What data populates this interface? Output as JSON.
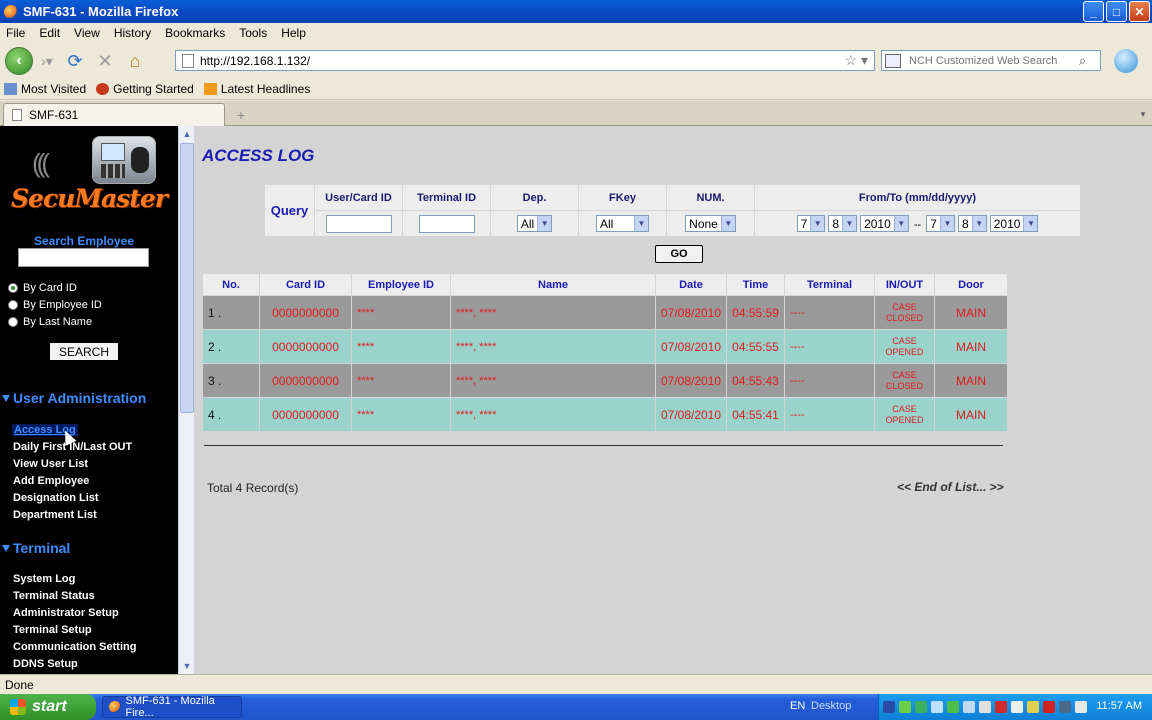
{
  "window": {
    "title": "SMF-631 - Mozilla Firefox",
    "controls": {
      "minimize": "_",
      "maximize": "□",
      "close": "✕"
    }
  },
  "menubar": [
    "File",
    "Edit",
    "View",
    "History",
    "Bookmarks",
    "Tools",
    "Help"
  ],
  "nav": {
    "url": "http://192.168.1.132/",
    "search_placeholder": "NCH Customized Web Search"
  },
  "bookmarks": [
    "Most Visited",
    "Getting Started",
    "Latest Headlines"
  ],
  "tab": {
    "label": "SMF-631"
  },
  "sidebar": {
    "brand": "SecuMaster",
    "search_title": "Search Employee",
    "radios": [
      {
        "label": "By Card ID",
        "checked": true
      },
      {
        "label": "By Employee ID",
        "checked": false
      },
      {
        "label": "By Last Name",
        "checked": false
      }
    ],
    "search_button": "SEARCH",
    "sections": [
      {
        "title": "User Administration",
        "links": [
          "Access Log",
          "Daily First IN/Last OUT",
          "View User List",
          "Add Employee",
          "Designation List",
          "Department List"
        ]
      },
      {
        "title": "Terminal",
        "links": [
          "System Log",
          "Terminal Status",
          "Administrator Setup",
          "Terminal Setup",
          "Communication Setting",
          "DDNS Setup"
        ]
      }
    ]
  },
  "page": {
    "title": "ACCESS LOG",
    "query": {
      "label": "Query",
      "headers": [
        "User/Card ID",
        "Terminal ID",
        "Dep.",
        "FKey",
        "NUM.",
        "From/To (mm/dd/yyyy)"
      ],
      "dep": "All",
      "fkey": "All",
      "num": "None",
      "from": {
        "month": "7",
        "day": "8",
        "year": "2010"
      },
      "to": {
        "month": "7",
        "day": "8",
        "year": "2010"
      },
      "separator": "--",
      "go_button": "GO"
    },
    "table": {
      "headers": [
        "No.",
        "Card ID",
        "Employee ID",
        "Name",
        "Date",
        "Time",
        "Terminal",
        "IN/OUT",
        "Door"
      ],
      "rows": [
        {
          "no": "1 .",
          "card_id": "0000000000",
          "employee_id": "****",
          "name": "****, ****",
          "date": "07/08/2010",
          "time": "04:55:59",
          "terminal": "----",
          "inout_1": "CASE",
          "inout_2": "CLOSED",
          "door": "MAIN"
        },
        {
          "no": "2 .",
          "card_id": "0000000000",
          "employee_id": "****",
          "name": "****, ****",
          "date": "07/08/2010",
          "time": "04:55:55",
          "terminal": "----",
          "inout_1": "CASE",
          "inout_2": "OPENED",
          "door": "MAIN"
        },
        {
          "no": "3 .",
          "card_id": "0000000000",
          "employee_id": "****",
          "name": "****, ****",
          "date": "07/08/2010",
          "time": "04:55:43",
          "terminal": "----",
          "inout_1": "CASE",
          "inout_2": "CLOSED",
          "door": "MAIN"
        },
        {
          "no": "4 .",
          "card_id": "0000000000",
          "employee_id": "****",
          "name": "****, ****",
          "date": "07/08/2010",
          "time": "04:55:41",
          "terminal": "----",
          "inout_1": "CASE",
          "inout_2": "OPENED",
          "door": "MAIN"
        }
      ]
    },
    "total": "Total 4 Record(s)",
    "end_of_list": "<< End of List... >>"
  },
  "status": "Done",
  "taskbar": {
    "start": "start",
    "task": "SMF-631 - Mozilla Fire...",
    "lang": "EN",
    "desktop": "Desktop",
    "clock": "11:57 AM"
  },
  "colors": {
    "title_blue": "#1a1ab4",
    "link_blue": "#3f8cff",
    "red_text": "#e21b1b",
    "row_gray": "#9a9a9a",
    "row_teal": "#9ad3cc"
  }
}
